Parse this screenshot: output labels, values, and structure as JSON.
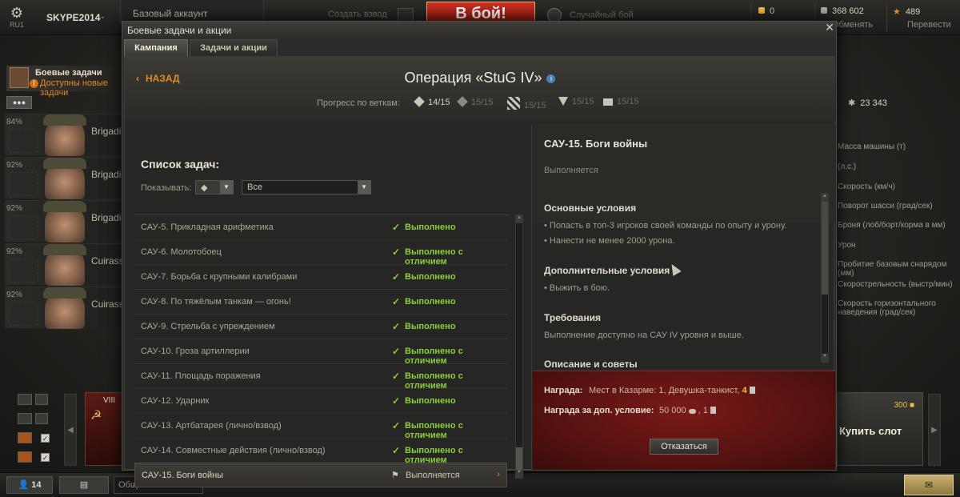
{
  "topbar": {
    "region": "RU1",
    "account_name": "SKYPE2014",
    "account_type": "Базовый аккаунт",
    "platoon_label": "Создать взвод",
    "battle_button": "В бой!",
    "battle_mode": "Случайный бой",
    "gold": "0",
    "credits": "368 602",
    "exchange_label": "Обменять",
    "free_xp": "489",
    "transfer_label": "Перевести"
  },
  "left_panel": {
    "tasks_title": "Боевые задачи",
    "tasks_subtitle": "Доступны новые задачи",
    "crew": [
      {
        "percent": "84%",
        "name": "Brigadier"
      },
      {
        "percent": "92%",
        "name": "Brigadier"
      },
      {
        "percent": "92%",
        "name": "Brigadier"
      },
      {
        "percent": "92%",
        "name": "Cuirassier"
      },
      {
        "percent": "92%",
        "name": "Cuirassier"
      }
    ],
    "tank_tier": "VIII"
  },
  "right_panel": {
    "total_xp": "23 343",
    "stats": [
      "Масса машины (т)",
      "(л.с.)",
      "Скорость (км/ч)",
      "Поворот шасси (град/сек)",
      "Броня (лоб/борт/корма в мм)",
      "Урон",
      "Пробитие базовым снарядом (мм)",
      "Скорострельность (выстр/мин)",
      "Скорость горизонтального наведения (град/сек)"
    ],
    "buy_slot_price": "300",
    "buy_slot_label": "Купить слот"
  },
  "bottombar": {
    "friends_count": "14",
    "chat_channel": "Общий"
  },
  "window": {
    "title": "Боевые задачи и акции",
    "tabs": [
      {
        "label": "Кампания",
        "active": true
      },
      {
        "label": "Задачи и акции",
        "active": false
      }
    ],
    "back_label": "НАЗАД",
    "operation_title": "Операция «StuG IV»",
    "progress_label": "Прогресс по веткам:",
    "branches": [
      {
        "icon": "diamond-icon",
        "value": "14/15"
      },
      {
        "icon": "diamond-outline-icon",
        "value": "15/15"
      },
      {
        "icon": "stripes-icon",
        "value": "15/15"
      },
      {
        "icon": "triangle-icon",
        "value": "15/15"
      },
      {
        "icon": "square-icon",
        "value": "15/15"
      }
    ],
    "task_list": {
      "title": "Список задач:",
      "show_label": "Показывать:",
      "filter_value": "Все",
      "items": [
        {
          "name": "САУ-5. Прикладная арифметика",
          "status": "Выполнено"
        },
        {
          "name": "САУ-6. Молотобоец",
          "status": "Выполнено с отличием"
        },
        {
          "name": "САУ-7. Борьба с крупными калибрами",
          "status": "Выполнено"
        },
        {
          "name": "САУ-8. По тяжёлым танкам — огонь!",
          "status": "Выполнено"
        },
        {
          "name": "САУ-9. Стрельба с упреждением",
          "status": "Выполнено"
        },
        {
          "name": "САУ-10. Гроза артиллерии",
          "status": "Выполнено с отличием"
        },
        {
          "name": "САУ-11. Площадь поражения",
          "status": "Выполнено с отличием"
        },
        {
          "name": "САУ-12. Ударник",
          "status": "Выполнено"
        },
        {
          "name": "САУ-13. Артбатарея (лично/взвод)",
          "status": "Выполнено с отличием"
        },
        {
          "name": "САУ-14. Совместные действия (лично/взвод)",
          "status": "Выполнено с отличием"
        },
        {
          "name": "САУ-15. Боги войны",
          "status": "Выполняется"
        }
      ]
    },
    "detail": {
      "title": "САУ-15. Боги войны",
      "status": "Выполняется",
      "main_conditions_title": "Основные условия",
      "main_conditions": [
        "• Попасть в топ-3 игроков своей команды по опыту и урону.",
        "• Нанести не менее 2000 урона."
      ],
      "extra_conditions_title": "Дополнительные условия",
      "extra_conditions": [
        "• Выжить в бою."
      ],
      "requirements_title": "Требования",
      "requirements_text": "Выполнение доступно на САУ IV уровня и выше.",
      "description_title": "Описание и советы",
      "reward_label": "Награда:",
      "reward_value": "Мест в Казарме: 1, Девушка-танкист,",
      "reward_count": "4",
      "extra_reward_label": "Награда за доп. условие:",
      "extra_reward_credits": "50 000",
      "extra_reward_count": ", 1",
      "decline_button": "Отказаться"
    }
  }
}
